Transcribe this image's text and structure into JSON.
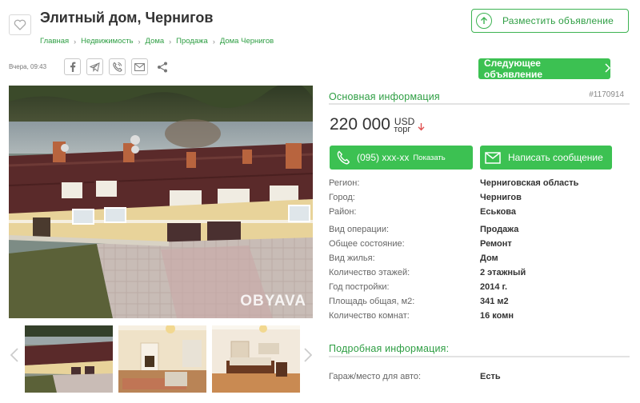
{
  "header": {
    "title": "Элитный дом, Чернигов",
    "post_ad_label": "Разместить объявление"
  },
  "breadcrumb": [
    "Главная",
    "Недвижимость",
    "Дома",
    "Продажа",
    "Дома Чернигов"
  ],
  "meta": {
    "date": "Вчера, 09:43",
    "next_label": "Следующее объявление"
  },
  "share_icons": [
    "facebook-icon",
    "telegram-icon",
    "viber-icon",
    "email-icon",
    "share-icon"
  ],
  "gallery": {
    "watermark": "OBYAVA",
    "thumbnails": [
      "thumb-house-exterior",
      "thumb-living-room",
      "thumb-bedroom"
    ]
  },
  "info": {
    "section_title": "Основная информация",
    "ad_id": "#1170914",
    "price": "220 000",
    "currency": "USD",
    "negotiable": "торг",
    "phone": "(095) xxx-xx",
    "phone_show": "Показать",
    "message_label": "Написать сообщение",
    "rows": [
      {
        "key": "Регион:",
        "value": "Черниговская область"
      },
      {
        "key": "Город:",
        "value": "Чернигов"
      },
      {
        "key": "Район:",
        "value": "Еськова"
      },
      {
        "key": "Вид операции:",
        "value": "Продажа"
      },
      {
        "key": "Общее состояние:",
        "value": "Ремонт"
      },
      {
        "key": "Вид жилья:",
        "value": "Дом"
      },
      {
        "key": "Количество этажей:",
        "value": "2 этажный"
      },
      {
        "key": "Год постройки:",
        "value": "2014 г."
      },
      {
        "key": "Площадь общая, м2:",
        "value": "341 м2"
      },
      {
        "key": "Количество комнат:",
        "value": "16 комн"
      }
    ],
    "details_title": "Подробная информация:",
    "detail_rows": [
      {
        "key": "Гараж/место для авто:",
        "value": "Есть"
      }
    ]
  },
  "colors": {
    "accent": "#3cc152",
    "link": "#2e9e43",
    "price_down": "#e05050"
  }
}
